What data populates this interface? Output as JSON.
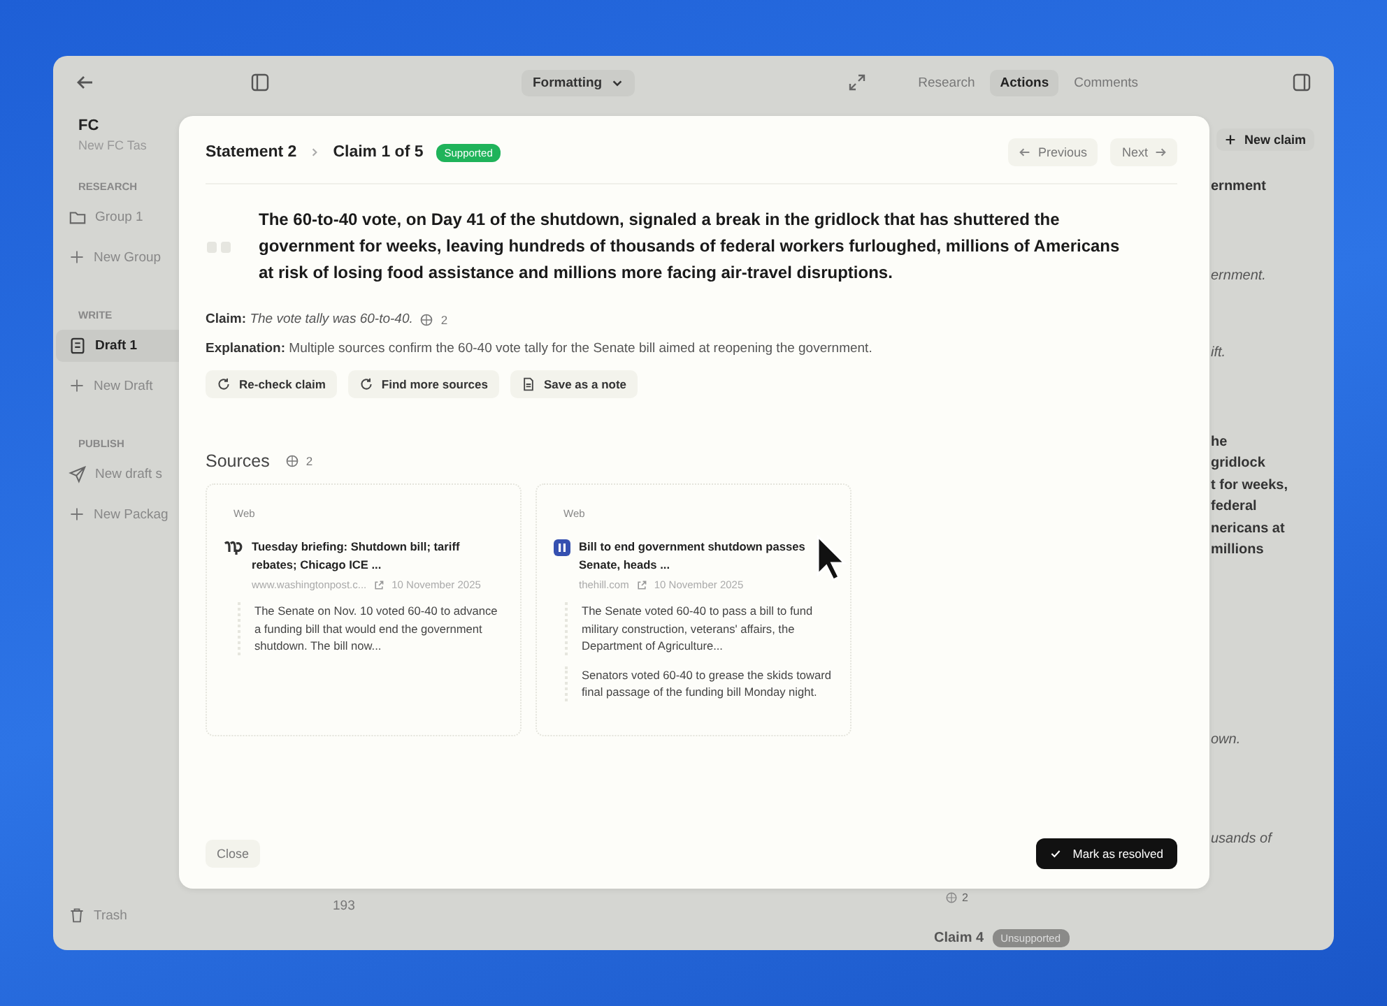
{
  "topbar": {
    "formatting": "Formatting",
    "tabs": [
      {
        "label": "Research",
        "selected": false
      },
      {
        "label": "Actions",
        "selected": true
      },
      {
        "label": "Comments",
        "selected": false
      }
    ]
  },
  "sidebar": {
    "title": "FC",
    "subtitle": "New FC Tas",
    "sections": [
      {
        "heading": "RESEARCH",
        "items": [
          {
            "kind": "folder",
            "label": "Group 1",
            "selected": false
          },
          {
            "kind": "add",
            "label": "New Group",
            "selected": false
          }
        ]
      },
      {
        "heading": "WRITE",
        "items": [
          {
            "kind": "draft",
            "label": "Draft 1",
            "selected": true
          },
          {
            "kind": "add",
            "label": "New Draft",
            "selected": false
          }
        ]
      },
      {
        "heading": "PUBLISH",
        "items": [
          {
            "kind": "send",
            "label": "New draft s",
            "selected": false
          },
          {
            "kind": "add",
            "label": "New Packag",
            "selected": false
          }
        ]
      }
    ],
    "footer": "Trash"
  },
  "background": {
    "count": "193",
    "right_panel": {
      "button": "New claim",
      "fragments": [
        {
          "lines": [
            "ernment"
          ]
        },
        {
          "lines": [
            "ernment."
          ]
        },
        {
          "lines": [
            "ift."
          ]
        },
        {
          "lines": [
            "he",
            "gridlock",
            "t for weeks,",
            "federal",
            "nericans at",
            "millions"
          ]
        },
        {
          "lines": [
            "own."
          ]
        },
        {
          "lines": [
            "usands of"
          ]
        }
      ],
      "claim_card": {
        "count": "2",
        "title": "Claim 4",
        "badge": "Unsupported"
      }
    }
  },
  "modal": {
    "statement": "Statement 2",
    "claim": "Claim 1 of 5",
    "badge": "Supported",
    "previous": "Previous",
    "next": "Next",
    "quote": "The 60-to-40 vote, on Day 41 of the shutdown, signaled a break in the gridlock that has shuttered the government for weeks, leaving hundreds of thousands of federal workers furloughed, millions of Americans at risk of losing food assistance and millions more facing air-travel disruptions.",
    "claim_label": "Claim:",
    "claim_text": "The vote tally was 60-to-40.",
    "claim_count": "2",
    "explanation_label": "Explanation:",
    "explanation_text": "Multiple sources confirm the 60-40 vote tally for the Senate bill aimed at reopening the government.",
    "actions": [
      {
        "kind": "refresh",
        "label": "Re-check claim"
      },
      {
        "kind": "refresh",
        "label": "Find more sources"
      },
      {
        "kind": "note",
        "label": "Save as a note"
      }
    ],
    "sources_title": "Sources",
    "sources_count": "2",
    "sources": [
      {
        "tag": "Web",
        "title": "Tuesday briefing: Shutdown bill; tariff rebates; Chicago ICE ...",
        "domain": "www.washingtonpost.c...",
        "date": "10 November 2025",
        "excerpts": [
          "The Senate on Nov. 10 voted 60-40 to advance a funding bill that would end the government shutdown. The bill now..."
        ]
      },
      {
        "tag": "Web",
        "title": "Bill to end government shutdown passes Senate, heads ...",
        "domain": "thehill.com",
        "date": "10 November 2025",
        "excerpts": [
          "The Senate voted 60-40 to pass a bill to fund military construction, veterans' affairs, the Department of Agriculture...",
          "Senators voted 60-40 to grease the skids toward final passage of the funding bill Monday night."
        ]
      }
    ],
    "close": "Close",
    "resolve": "Mark as resolved"
  }
}
